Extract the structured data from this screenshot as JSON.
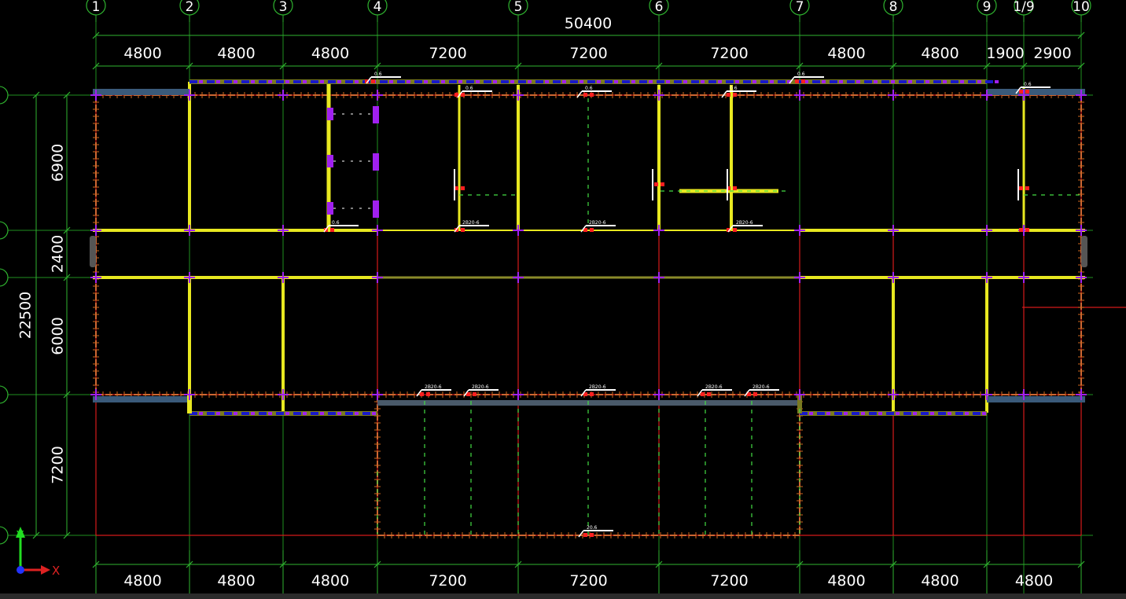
{
  "colors": {
    "background": "#000000",
    "axis_line": "#1f8f1f",
    "dimension": "#2fb32f",
    "beam": "#e8e820",
    "beam_secondary": "#8a8a2a",
    "red_line": "#d41a1a",
    "column_marker": "#a020f0",
    "blue_hatch": "#1818c8",
    "green_dash": "#44dd44",
    "tag": "#ffffff"
  },
  "axes_x": [
    "1",
    "2",
    "3",
    "4",
    "5",
    "6",
    "7",
    "8",
    "9",
    "1/9",
    "10"
  ],
  "top_total": "50400",
  "top_dims": [
    "4800",
    "4800",
    "4800",
    "7200",
    "7200",
    "7200",
    "4800",
    "4800",
    "1900",
    "2900"
  ],
  "bottom_dims": [
    "4800",
    "4800",
    "4800",
    "7200",
    "7200",
    "7200",
    "4800",
    "4800",
    "4800"
  ],
  "left_dims": [
    "6900",
    "2400",
    "6000",
    "7200"
  ],
  "left_total": "22500",
  "beam_tags": {
    "wall": "0.6",
    "beam": "2B20-6",
    "bottom": "20.6"
  },
  "ucs": {
    "x": "X",
    "y": "Y"
  },
  "icons": {
    "axis_bubble": "axis-bubble-icon",
    "ucs": "ucs-icon"
  }
}
